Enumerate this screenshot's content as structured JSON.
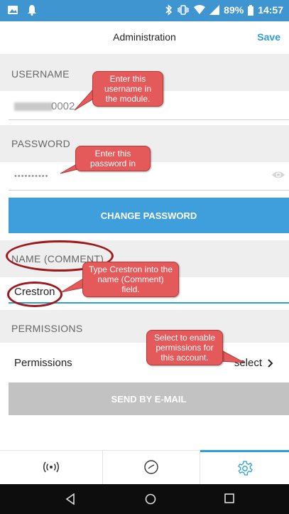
{
  "status_bar": {
    "battery_pct": "89%",
    "time": "14:57"
  },
  "header": {
    "title": "Administration",
    "save_label": "Save"
  },
  "username": {
    "label": "USERNAME",
    "value_suffix": "0002",
    "callout": "Enter this username in the module."
  },
  "password": {
    "label": "PASSWORD",
    "value": "••••••••••",
    "callout": "Enter this password in"
  },
  "change_password_label": "CHANGE PASSWORD",
  "name": {
    "label": "NAME (COMMENT)",
    "value": "Crestron",
    "callout": "Type Crestron into the name (Comment) field."
  },
  "permissions": {
    "section_label": "PERMISSIONS",
    "row_label": "Permissions",
    "select_label": "select",
    "callout": "Select to enable permissions for this account."
  },
  "send_email_label": "SEND BY E-MAIL",
  "tabs": [
    {
      "icon": "wireless-icon"
    },
    {
      "icon": "clock-icon"
    },
    {
      "icon": "gear-icon"
    }
  ],
  "colors": {
    "accent": "#2a9fd8",
    "status_bar": "#3f95d0",
    "callout": "#e45a5a",
    "disabled_button": "#c2c2c2"
  }
}
